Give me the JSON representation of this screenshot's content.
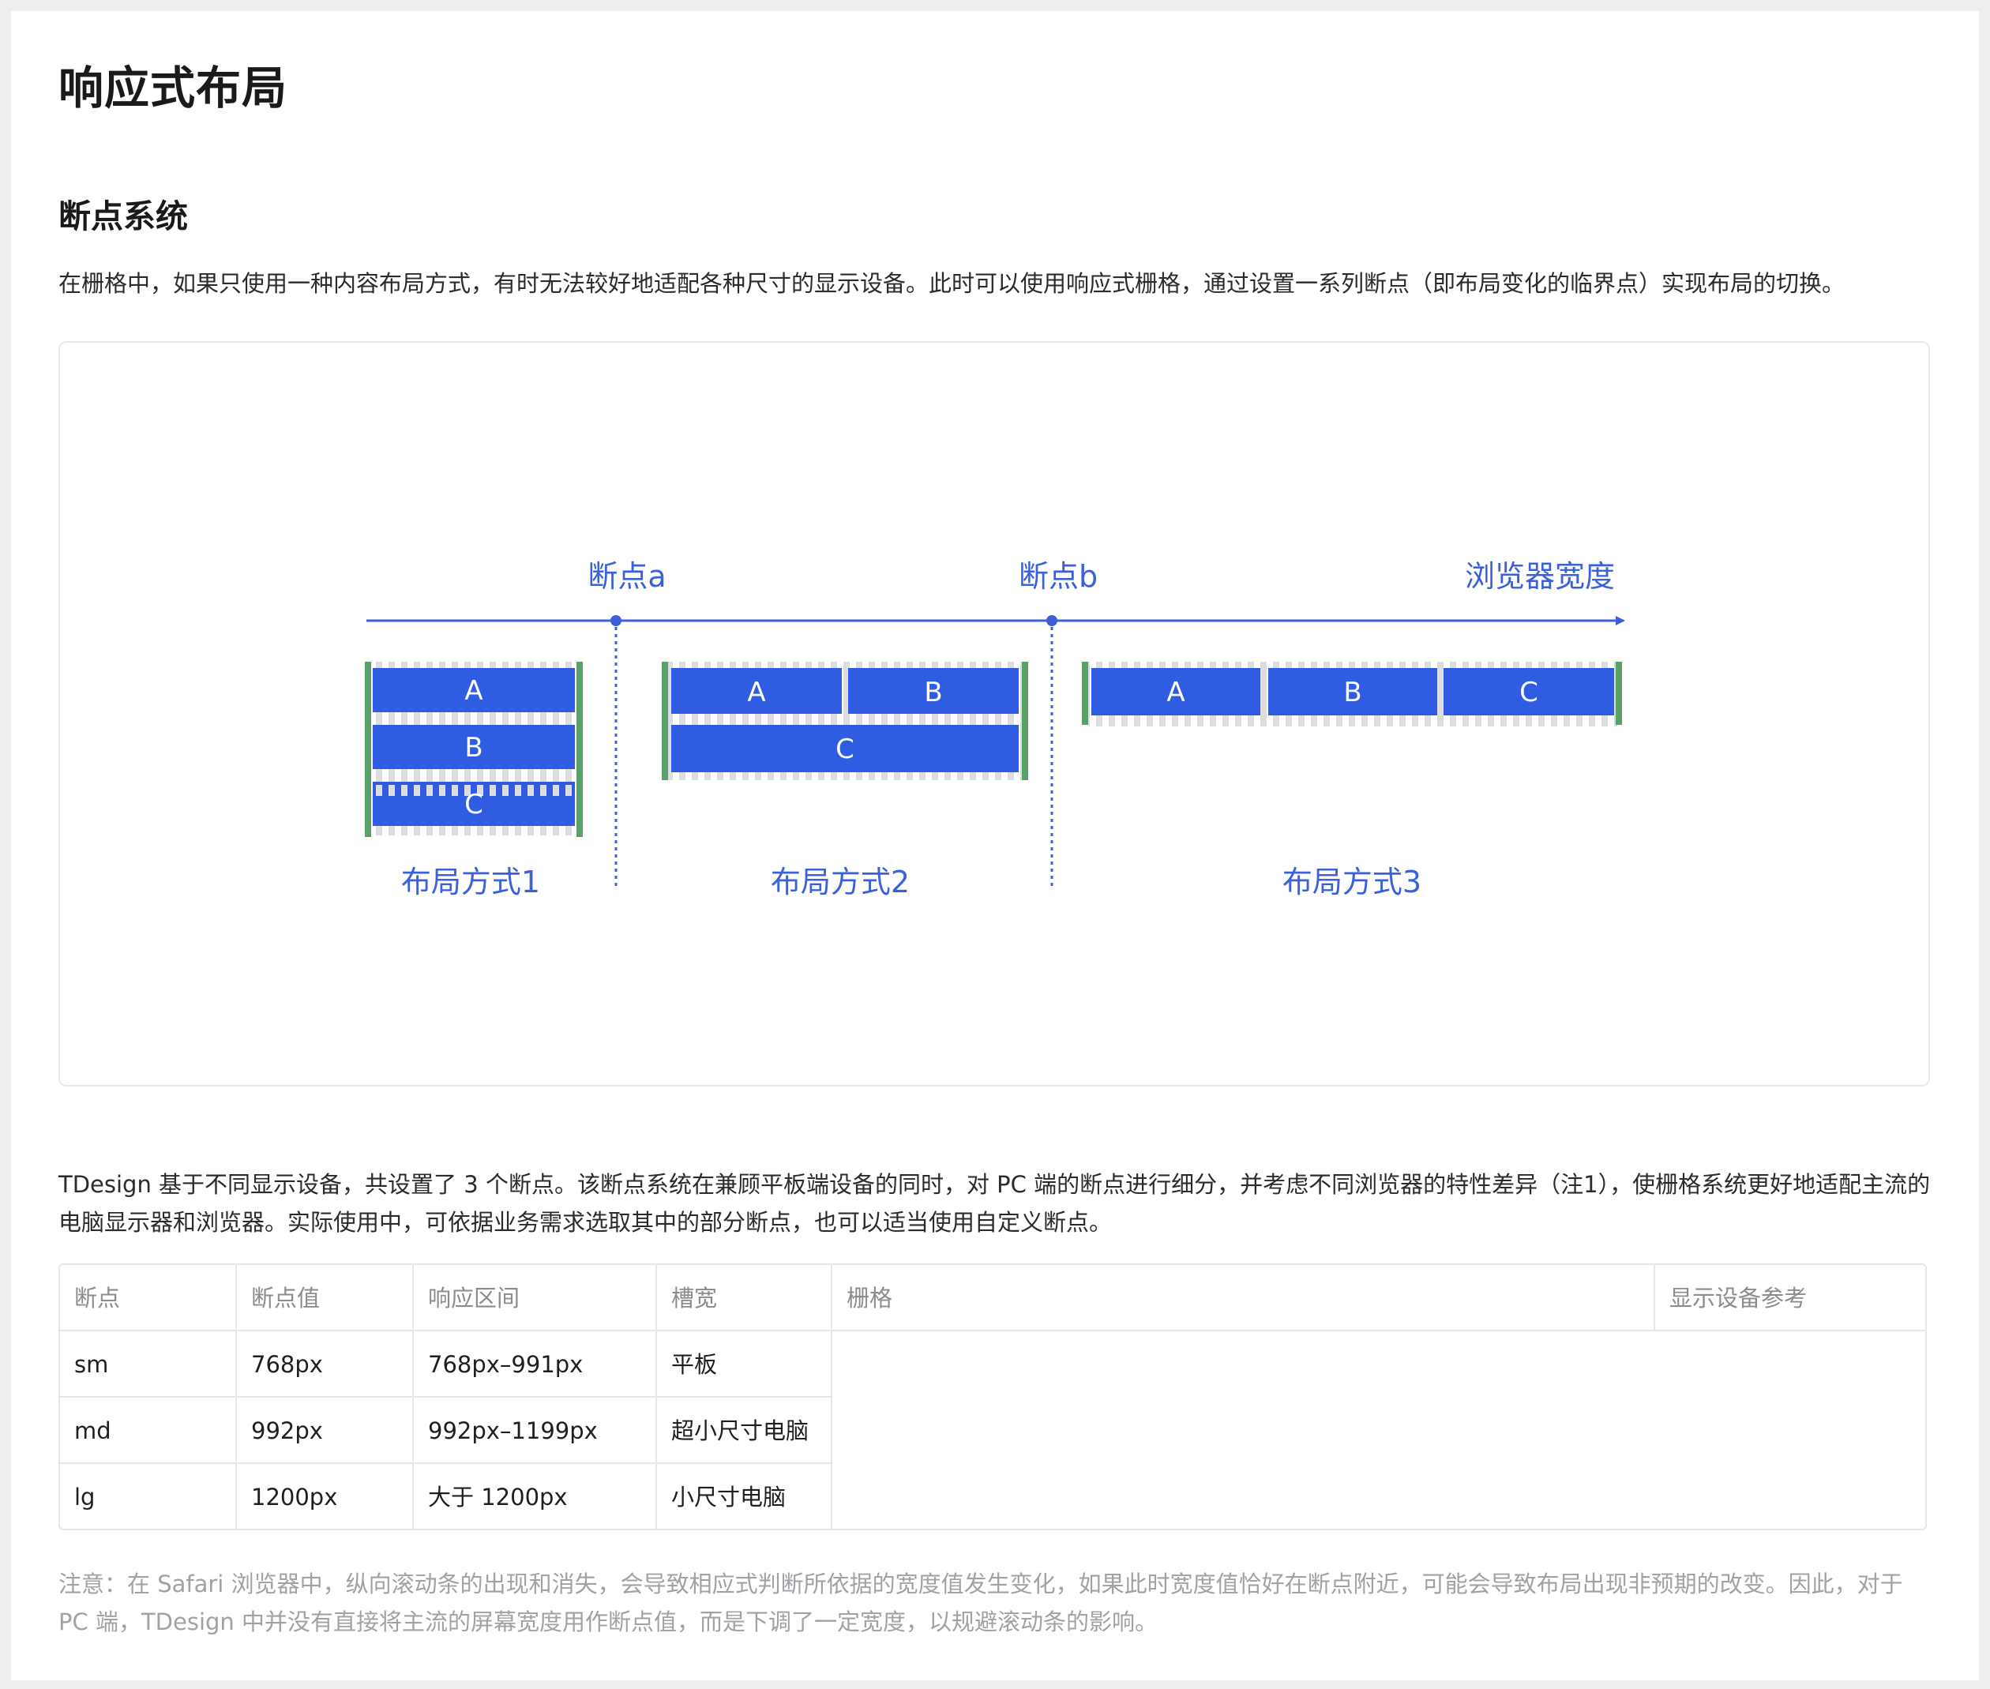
{
  "title": "响应式布局",
  "section_title": "断点系统",
  "intro": "在栅格中，如果只使用一种内容布局方式，有时无法较好地适配各种尺寸的显示设备。此时可以使用响应式栅格，通过设置一系列断点（即布局变化的临界点）实现布局的切换。",
  "diagram": {
    "breakpoint_a": "断点a",
    "breakpoint_b": "断点b",
    "axis_label": "浏览器宽度",
    "layout_1": "布局方式1",
    "layout_2": "布局方式2",
    "layout_3": "布局方式3",
    "block_a": "A",
    "block_b": "B",
    "block_c": "C",
    "colors": {
      "accent": "#3a61d9",
      "block": "#2f5ce0",
      "edge": "#5aa06a",
      "gutter": "#dcdde3"
    }
  },
  "description": "TDesign 基于不同显示设备，共设置了 3 个断点。该断点系统在兼顾平板端设备的同时，对 PC 端的断点进行细分，并考虑不同浏览器的特性差异（注1），使栅格系统更好地适配主流的电脑显示器和浏览器。实际使用中，可依据业务需求选取其中的部分断点，也可以适当使用自定义断点。",
  "table": {
    "headers": [
      "断点",
      "断点值",
      "响应区间",
      "槽宽",
      "栅格",
      "显示设备参考"
    ],
    "rows": [
      [
        "sm",
        "768px",
        "768px–991px",
        "平板"
      ],
      [
        "md",
        "992px",
        "992px–1199px",
        "超小尺寸电脑"
      ],
      [
        "lg",
        "1200px",
        "大于 1200px",
        "小尺寸电脑"
      ]
    ]
  },
  "note": "注意：在 Safari 浏览器中，纵向滚动条的出现和消失，会导致相应式判断所依据的宽度值发生变化，如果此时宽度值恰好在断点附近，可能会导致布局出现非预期的改变。因此，对于 PC 端，TDesign 中并没有直接将主流的屏幕宽度用作断点值，而是下调了一定宽度，以规避滚动条的影响。"
}
